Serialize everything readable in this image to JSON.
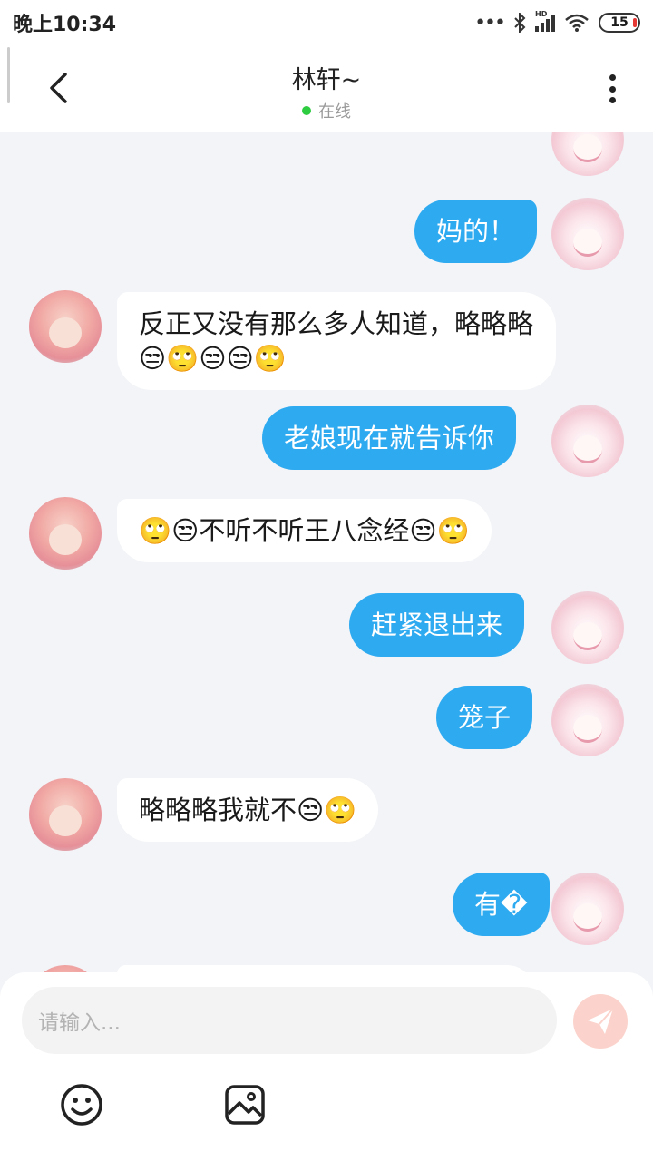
{
  "status_bar": {
    "time": "晚上10:34",
    "dots": "•••",
    "network": "HD",
    "battery": "15",
    "icons": [
      "bluetooth-icon",
      "signal-icon",
      "wifi-icon",
      "battery-icon"
    ]
  },
  "header": {
    "title": "林轩~",
    "status": "在线",
    "status_color": "#2ecc40",
    "back_icon": "chevron-left-icon",
    "menu_icon": "more-vertical-icon"
  },
  "messages": [
    {
      "side": "right",
      "text": "👿👿"
    },
    {
      "side": "right",
      "text": "妈的！"
    },
    {
      "side": "left",
      "text": "反正又没有那么多人知道，略略略😒🙄😒😒🙄"
    },
    {
      "side": "right",
      "text": "老娘现在就告诉你"
    },
    {
      "side": "left",
      "text": "🙄😒不听不听王八念经😒🙄"
    },
    {
      "side": "right",
      "text": "赶紧退出来"
    },
    {
      "side": "right",
      "text": "笼子"
    },
    {
      "side": "left",
      "text": "略略略我就不😒🙄"
    },
    {
      "side": "right",
      "text": "有�"
    }
  ],
  "input": {
    "placeholder": "请输入...",
    "value": ""
  },
  "colors": {
    "outgoing_bubble": "#2eaaf1",
    "incoming_bubble": "#ffffff",
    "send_button": "#fbd3cc"
  },
  "toolbar": {
    "emoji_icon": "smiley-icon",
    "image_icon": "image-icon",
    "send_icon": "send-icon"
  }
}
